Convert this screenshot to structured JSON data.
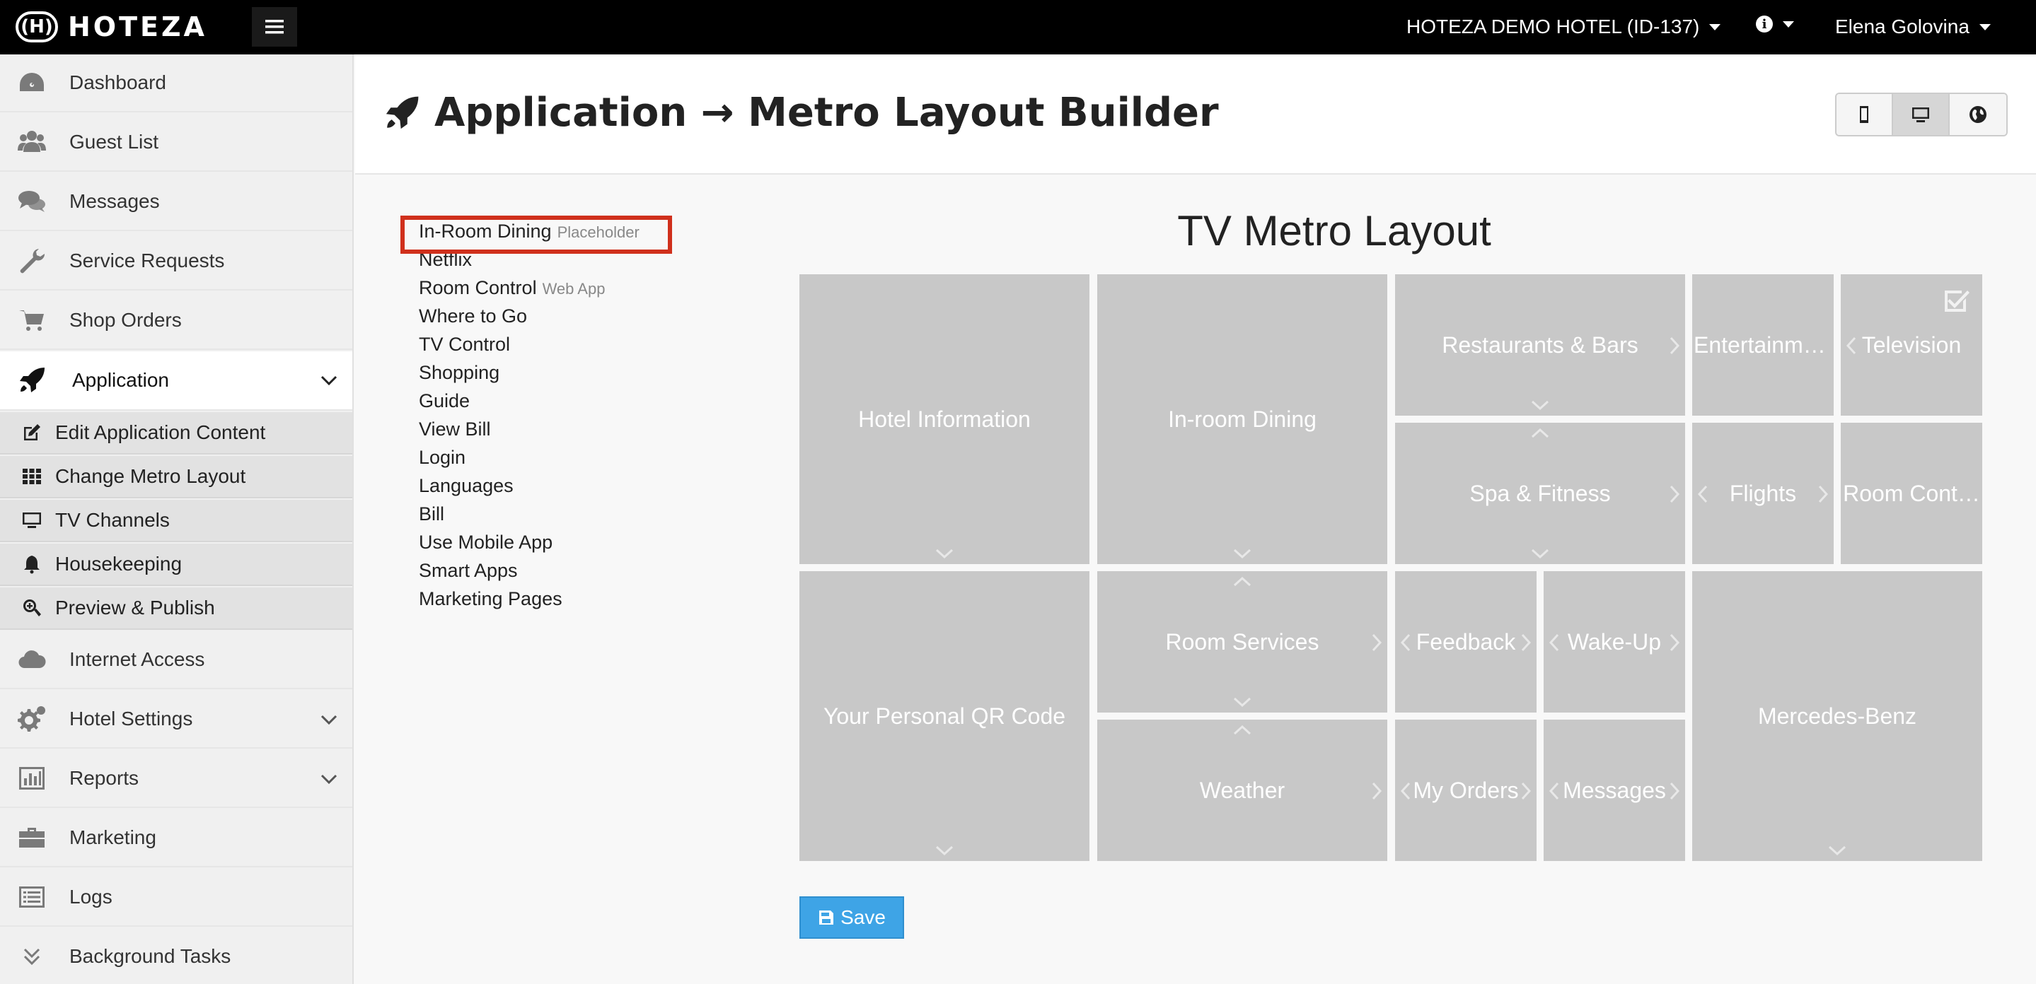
{
  "topbar": {
    "logo_mark": "(H)",
    "logo_text": "HOTEZA",
    "hotel": "HOTEZA DEMO HOTEL (ID-137)",
    "user": "Elena Golovina"
  },
  "sidebar": {
    "items": [
      {
        "label": "Dashboard",
        "icon": "dashboard-icon"
      },
      {
        "label": "Guest List",
        "icon": "users-icon"
      },
      {
        "label": "Messages",
        "icon": "comments-icon"
      },
      {
        "label": "Service Requests",
        "icon": "wrench-icon"
      },
      {
        "label": "Shop Orders",
        "icon": "cart-icon"
      },
      {
        "label": "Application",
        "icon": "rocket-icon"
      },
      {
        "label": "Internet Access",
        "icon": "cloud-icon"
      },
      {
        "label": "Hotel Settings",
        "icon": "gears-icon"
      },
      {
        "label": "Reports",
        "icon": "chart-icon"
      },
      {
        "label": "Marketing",
        "icon": "briefcase-icon"
      },
      {
        "label": "Logs",
        "icon": "list-icon"
      },
      {
        "label": "Background Tasks",
        "icon": "double-chevron-icon"
      }
    ],
    "sub_items": [
      {
        "label": "Edit Application Content",
        "icon": "edit-icon"
      },
      {
        "label": "Change Metro Layout",
        "icon": "grid-icon"
      },
      {
        "label": "TV Channels",
        "icon": "monitor-icon"
      },
      {
        "label": "Housekeeping",
        "icon": "bell-icon"
      },
      {
        "label": "Preview & Publish",
        "icon": "search-plus-icon"
      }
    ]
  },
  "header": {
    "title": "Application → Metro Layout Builder"
  },
  "item_list": [
    {
      "label": "In-Room Dining",
      "tag": "Placeholder"
    },
    {
      "label": "Netflix",
      "tag": ""
    },
    {
      "label": "Room Control",
      "tag": "Web App"
    },
    {
      "label": "Where to Go",
      "tag": ""
    },
    {
      "label": "TV Control",
      "tag": ""
    },
    {
      "label": "Shopping",
      "tag": ""
    },
    {
      "label": "Guide",
      "tag": ""
    },
    {
      "label": "View Bill",
      "tag": ""
    },
    {
      "label": "Login",
      "tag": ""
    },
    {
      "label": "Languages",
      "tag": ""
    },
    {
      "label": "Bill",
      "tag": ""
    },
    {
      "label": "Use Mobile App",
      "tag": ""
    },
    {
      "label": "Smart Apps",
      "tag": ""
    },
    {
      "label": "Marketing Pages",
      "tag": ""
    }
  ],
  "metro": {
    "title": "TV Metro Layout",
    "tiles": {
      "hotel_information": "Hotel Information",
      "in_room_dining": "In-room Dining",
      "restaurants_bars": "Restaurants & Bars",
      "entertainment": "Entertainment",
      "television": "Television",
      "spa_fitness": "Spa & Fitness",
      "flights": "Flights",
      "room_control": "Room Cont…",
      "qr_code": "Your Personal QR Code",
      "room_services": "Room Services",
      "feedback": "Feedback",
      "wake_up": "Wake-Up",
      "mercedes_benz": "Mercedes-Benz",
      "weather": "Weather",
      "my_orders": "My Orders",
      "messages": "Messages"
    }
  },
  "save_label": "Save",
  "colors": {
    "topbar": "#000000",
    "tile": "#c8c8c8",
    "highlight": "#d0301c",
    "save_button": "#3ea4e6"
  }
}
